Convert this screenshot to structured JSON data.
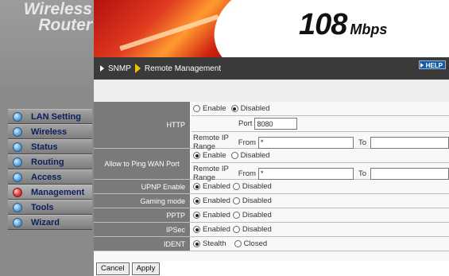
{
  "logo": {
    "line1": "Wireless",
    "line2": "Router"
  },
  "banner": {
    "speed": "108",
    "unit": "Mbps"
  },
  "breadcrumb": {
    "parent": "SNMP",
    "current": "Remote Management"
  },
  "help_label": "HELP",
  "nav": [
    {
      "label": "LAN Setting",
      "active": false
    },
    {
      "label": "Wireless",
      "active": false
    },
    {
      "label": "Status",
      "active": false
    },
    {
      "label": "Routing",
      "active": false
    },
    {
      "label": "Access",
      "active": false
    },
    {
      "label": "Management",
      "active": true
    },
    {
      "label": "Tools",
      "active": false
    },
    {
      "label": "Wizard",
      "active": false
    }
  ],
  "http": {
    "label": "HTTP",
    "enable": "Enable",
    "disabled": "Disabled",
    "selected": "Disabled",
    "port_label": "Port",
    "port_value": "8080",
    "range_label": "Remote IP Range",
    "from_label": "From",
    "from_value": "*",
    "to_label": "To",
    "to_value": ""
  },
  "ping": {
    "label": "Allow to Ping WAN Port",
    "enable": "Enable",
    "disabled": "Disabled",
    "selected": "Enable",
    "range_label": "Remote IP Range",
    "from_label": "From",
    "from_value": "*",
    "to_label": "To",
    "to_value": ""
  },
  "toggles": [
    {
      "label": "UPNP Enable",
      "on": "Enabled",
      "off": "Disabled",
      "selected": "Enabled"
    },
    {
      "label": "Gaming mode",
      "on": "Enabled",
      "off": "Disabled",
      "selected": "Enabled"
    },
    {
      "label": "PPTP",
      "on": "Enabled",
      "off": "Disabled",
      "selected": "Enabled"
    },
    {
      "label": "IPSec",
      "on": "Enabled",
      "off": "Disabled",
      "selected": "Enabled"
    },
    {
      "label": "IDENT",
      "on": "Stealth",
      "off": "Closed",
      "selected": "Stealth"
    }
  ],
  "buttons": {
    "cancel": "Cancel",
    "apply": "Apply"
  }
}
